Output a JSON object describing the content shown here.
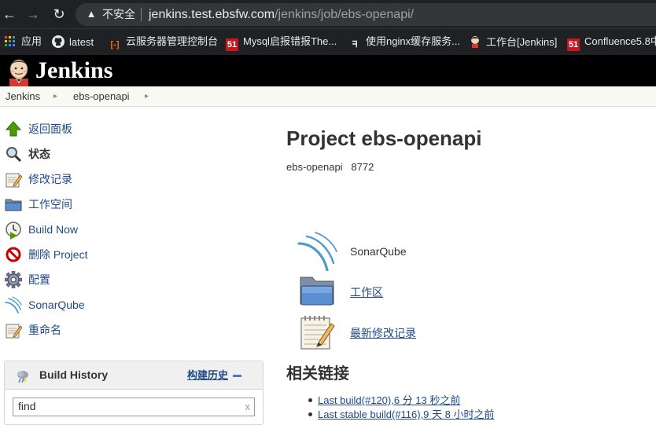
{
  "browser": {
    "security_label": "不安全",
    "url_host": "jenkins.test.ebsfw.com",
    "url_path": "/jenkins/job/ebs-openapi/",
    "bookmarks": [
      {
        "label": "应用",
        "icon": "apps-grid-icon"
      },
      {
        "label": "latest",
        "icon": "github-icon"
      },
      {
        "label": "云服务器管理控制台",
        "icon": "aliyun-icon"
      },
      {
        "label": "Mysql启报错报The...",
        "icon": "51cto-icon"
      },
      {
        "label": "使用nginx缓存服务...",
        "icon": "bird-icon"
      },
      {
        "label": "工作台[Jenkins]",
        "icon": "jenkins-butler-icon"
      },
      {
        "label": "Confluence5.8中",
        "icon": "51cto-icon"
      }
    ]
  },
  "header": {
    "title": "Jenkins"
  },
  "breadcrumbs": [
    "Jenkins",
    "ebs-openapi"
  ],
  "sidebar": {
    "tasks": [
      {
        "label": "返回面板",
        "icon": "up-arrow-icon"
      },
      {
        "label": "状态",
        "icon": "magnifier-icon"
      },
      {
        "label": "修改记录",
        "icon": "notepad-icon"
      },
      {
        "label": "工作空间",
        "icon": "folder-icon"
      },
      {
        "label": "Build Now",
        "icon": "clock-play-icon"
      },
      {
        "label": "删除 Project",
        "icon": "no-entry-icon"
      },
      {
        "label": "配置",
        "icon": "gear-icon"
      },
      {
        "label": "SonarQube",
        "icon": "sonarqube-icon"
      },
      {
        "label": "重命名",
        "icon": "notepad-icon"
      }
    ],
    "build_history": {
      "title": "Build History",
      "trend_label": "构建历史",
      "filter_value": "find",
      "clear_label": "x"
    }
  },
  "main": {
    "title": "Project ebs-openapi",
    "description": "ebs-openapi   8772",
    "links": [
      {
        "label": "SonarQube",
        "icon": "sonarqube-icon"
      },
      {
        "label": "工作区",
        "icon": "folder-icon"
      },
      {
        "label": "最新修改记录",
        "icon": "notepad-icon"
      }
    ],
    "related_title": "相关链接",
    "permalinks": [
      {
        "link": "Last build(#120),6 分 13 秒之前"
      },
      {
        "link": "Last stable build(#116),9 天 8 小时之前"
      }
    ]
  }
}
